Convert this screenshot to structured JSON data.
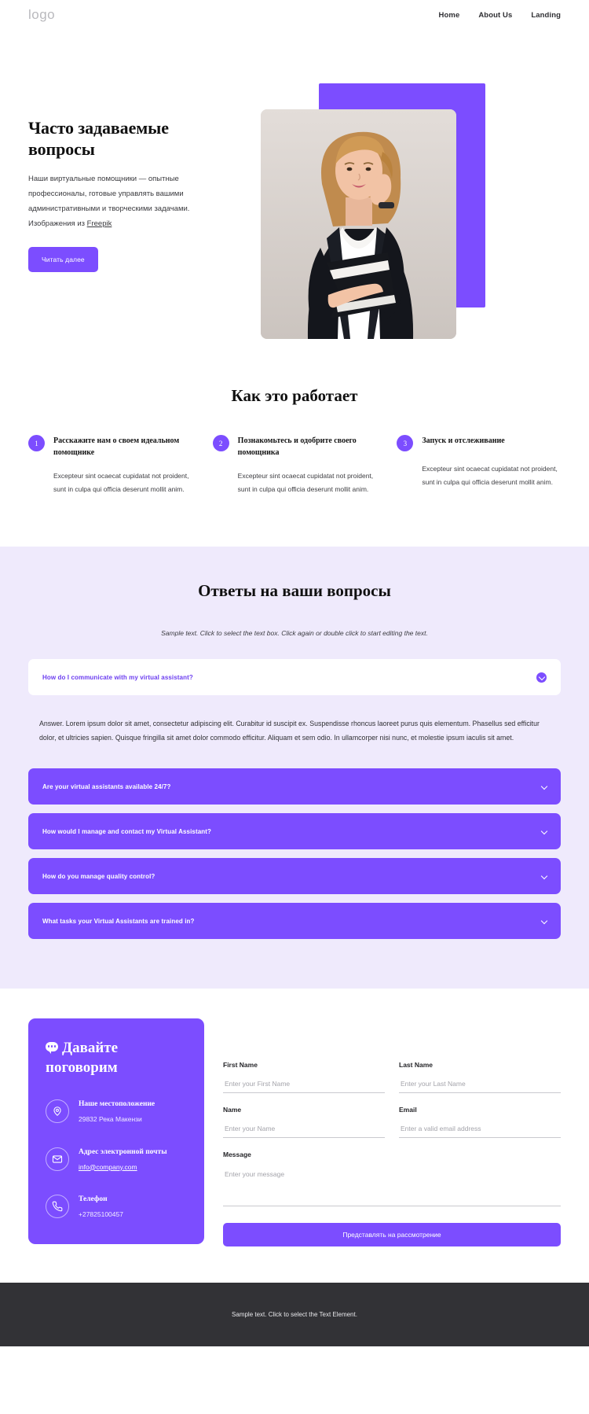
{
  "header": {
    "logo": "logo",
    "nav": [
      {
        "label": "Home"
      },
      {
        "label": "About Us"
      },
      {
        "label": "Landing"
      }
    ]
  },
  "hero": {
    "title": "Часто задаваемые вопросы",
    "paragraph": "Наши виртуальные помощники — опытные профессионалы, готовые управлять вашими административными и творческими задачами. Изображения из ",
    "link_label": "Freepik",
    "cta": "Читать далее",
    "image_alt": "Деловая женщина с папкой и телефоном"
  },
  "how": {
    "title": "Как это работает",
    "steps": [
      {
        "number": "1",
        "title": "Расскажите нам о своем идеальном помощнике",
        "body": "Excepteur sint ocaecat cupidatat not proident, sunt in culpa qui officia deserunt mollit anim."
      },
      {
        "number": "2",
        "title": "Познакомьтесь и одобрите своего помощника",
        "body": "Excepteur sint ocaecat cupidatat not proident, sunt in culpa qui officia deserunt mollit anim."
      },
      {
        "number": "3",
        "title": "Запуск и отслеживание",
        "body": "Excepteur sint ocaecat cupidatat not proident, sunt in culpa qui officia deserunt mollit anim."
      }
    ]
  },
  "faq": {
    "title": "Ответы на ваши вопросы",
    "subtitle": "Sample text. Click to select the text box. Click again or double click to start editing the text.",
    "open_item": {
      "question": "How do I communicate with my virtual assistant?",
      "answer": "Answer. Lorem ipsum dolor sit amet, consectetur adipiscing elit. Curabitur id suscipit ex. Suspendisse rhoncus laoreet purus quis elementum. Phasellus sed efficitur dolor, et ultricies sapien. Quisque fringilla sit amet dolor commodo efficitur. Aliquam et sem odio. In ullamcorper nisi nunc, et molestie ipsum iaculis sit amet."
    },
    "closed_items": [
      {
        "question": "Are your virtual assistants available 24/7?"
      },
      {
        "question": "How would I manage and contact my Virtual Assistant?"
      },
      {
        "question": "How do you manage quality control?"
      },
      {
        "question": "What tasks your Virtual Assistants are trained in?"
      }
    ]
  },
  "contact": {
    "heading": "Давайте поговорим",
    "items": [
      {
        "icon": "location-pin-icon",
        "label": "Наше местоположение",
        "value": "29832 Река Макензи"
      },
      {
        "icon": "envelope-icon",
        "label": "Адрес электронной почты",
        "value": "info@company.com"
      },
      {
        "icon": "phone-icon",
        "label": "Телефон",
        "value": "+27825100457"
      }
    ],
    "form": {
      "first_name_label": "First Name",
      "first_name_placeholder": "Enter your First Name",
      "last_name_label": "Last Name",
      "last_name_placeholder": "Enter your Last Name",
      "name_label": "Name",
      "name_placeholder": "Enter your Name",
      "email_label": "Email",
      "email_placeholder": "Enter a valid email address",
      "message_label": "Message",
      "message_placeholder": "Enter your message",
      "submit_label": "Представлять на рассмотрение"
    }
  },
  "footer": {
    "text": "Sample text. Click to select the Text Element."
  },
  "colors": {
    "accent": "#7c4dff",
    "faq_bg": "#efeafc",
    "footer_bg": "#323236"
  }
}
